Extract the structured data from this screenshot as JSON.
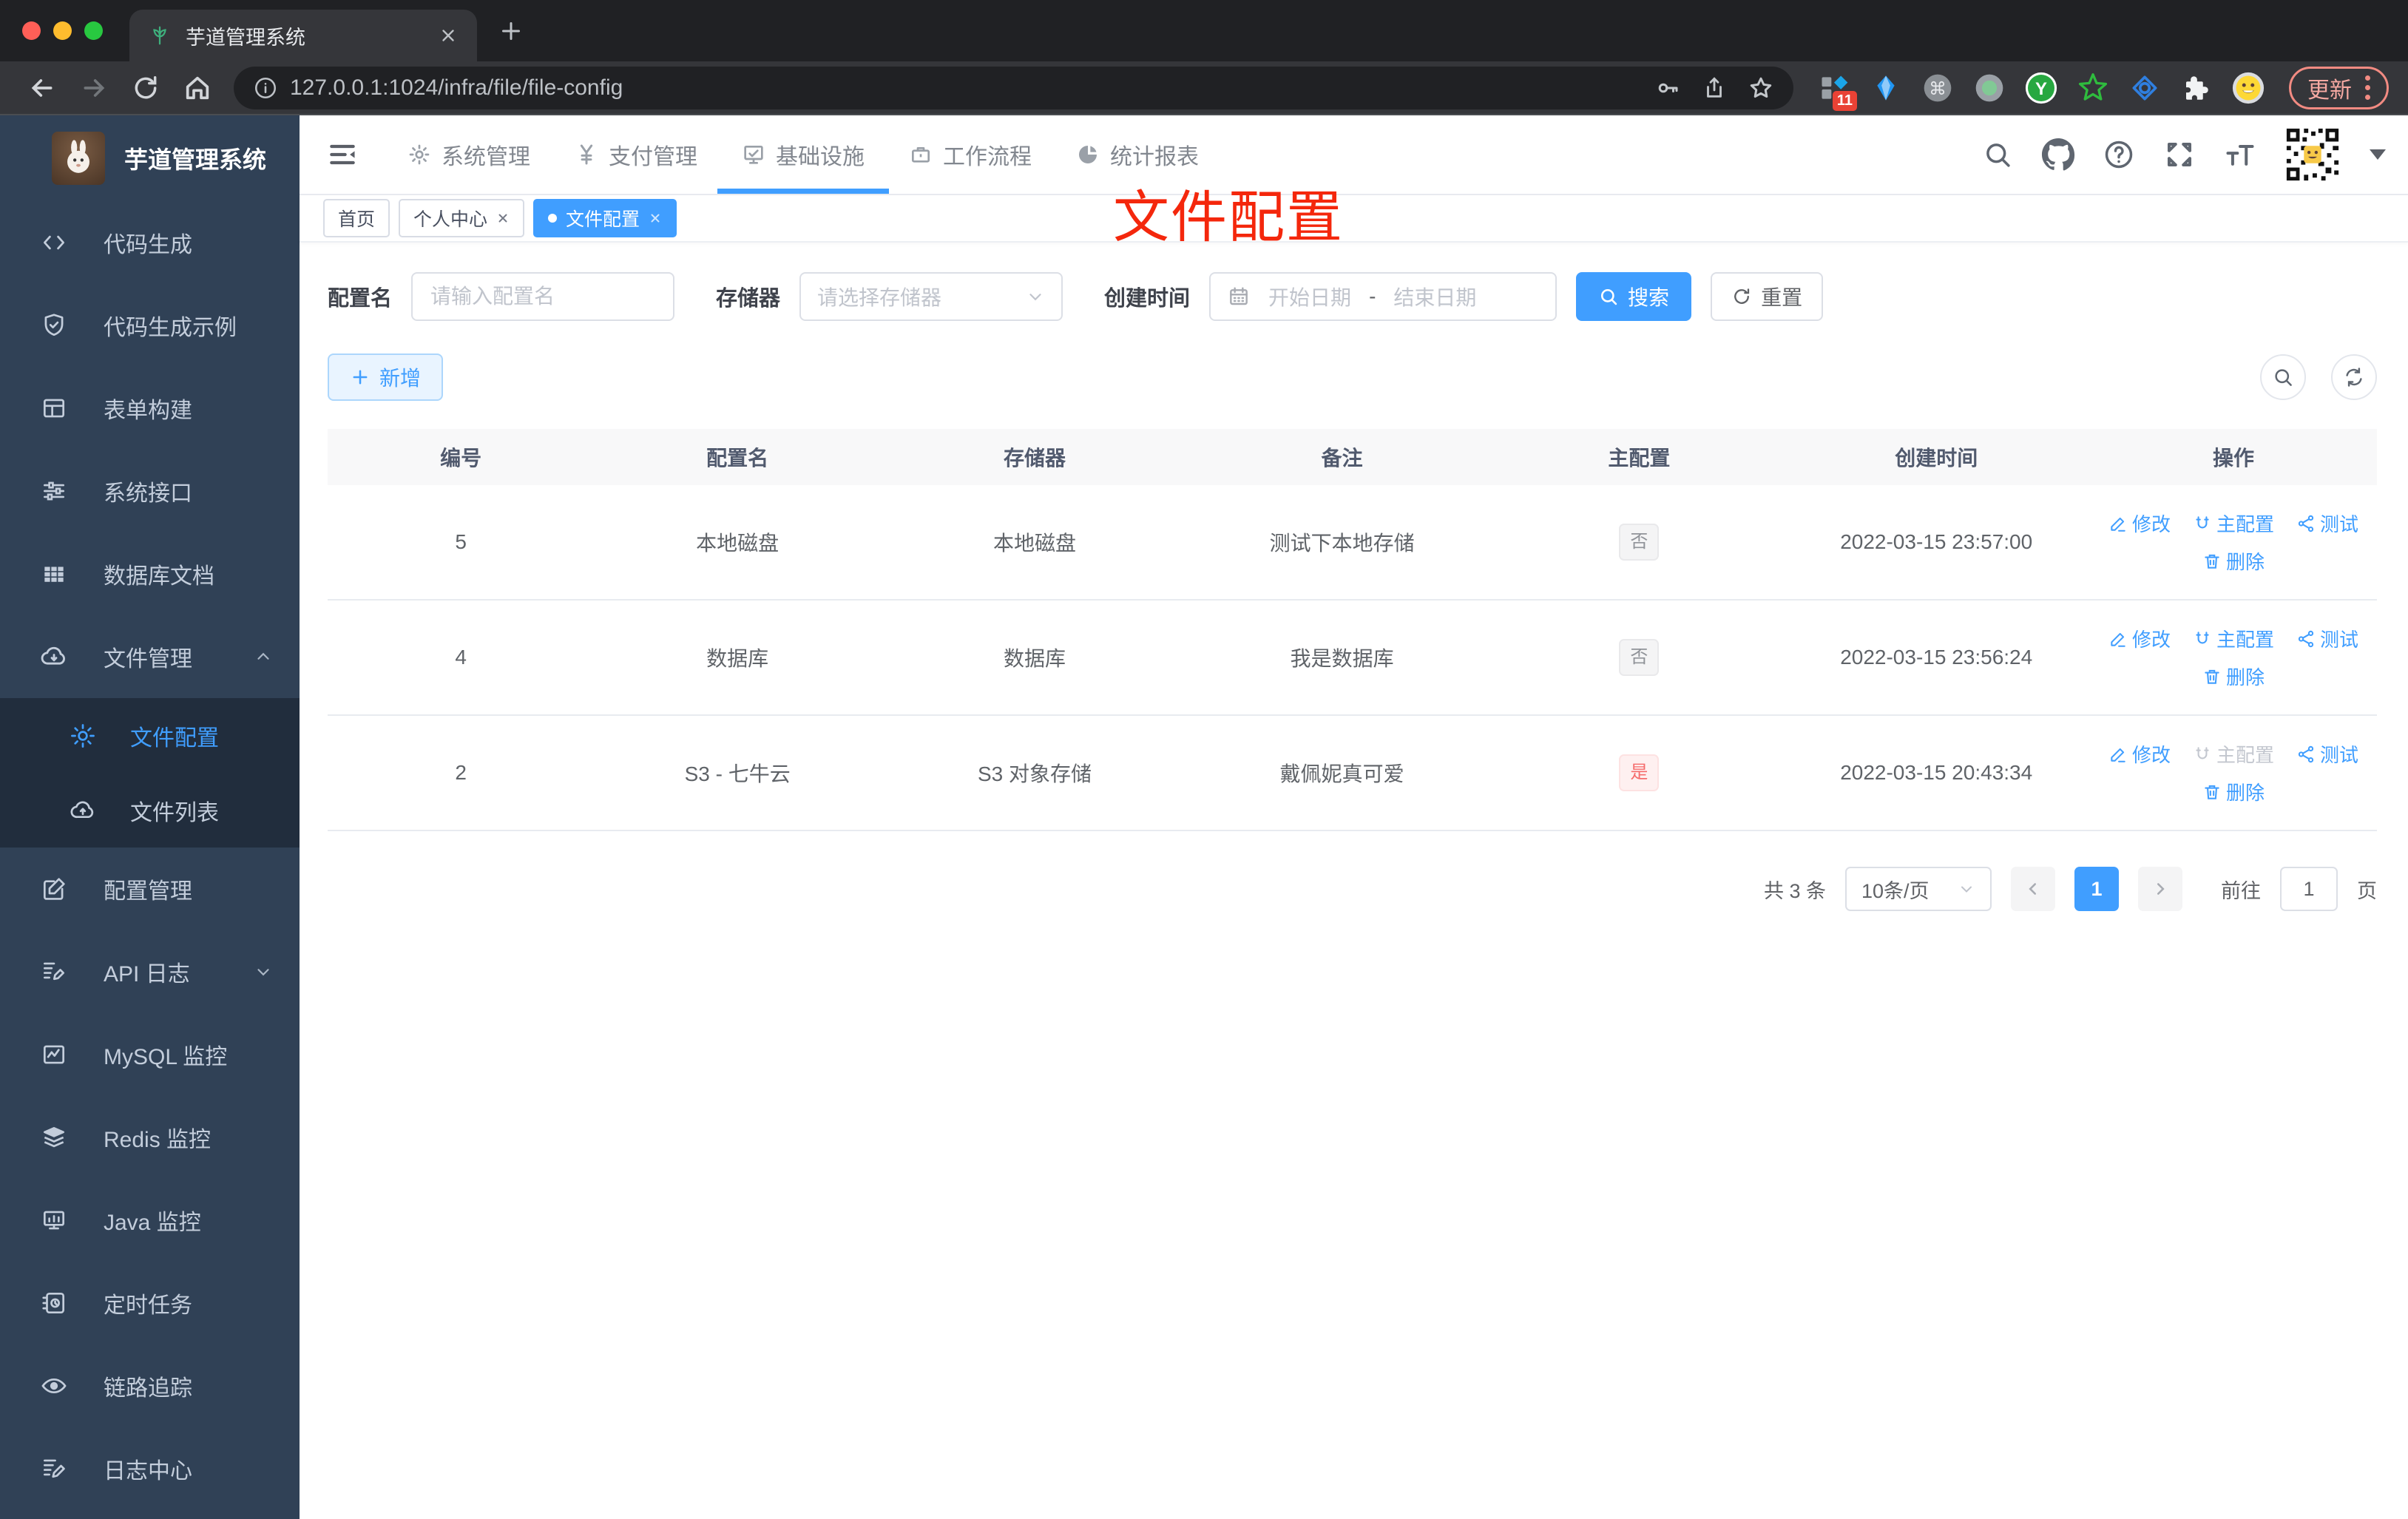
{
  "browser": {
    "tab_title": "芋道管理系统",
    "url": "127.0.0.1:1024/infra/file/file-config",
    "ext_badge": "11",
    "update_label": "更新"
  },
  "colors": {
    "accent": "#409eff",
    "sidebar_bg": "#304156",
    "submenu_bg": "#212d3d",
    "annotation_red": "#f4270c",
    "badge_no_text": "#909399",
    "badge_yes_text": "#f56c6c"
  },
  "sidebar": {
    "title": "芋道管理系统",
    "items": [
      {
        "label": "代码生成",
        "icon": "code-icon"
      },
      {
        "label": "代码生成示例",
        "icon": "shield-check-icon"
      },
      {
        "label": "表单构建",
        "icon": "form-icon"
      },
      {
        "label": "系统接口",
        "icon": "sliders-icon"
      },
      {
        "label": "数据库文档",
        "icon": "grid-icon"
      },
      {
        "label": "文件管理",
        "icon": "cloud-download-icon",
        "expanded": true,
        "children": [
          {
            "label": "文件配置",
            "icon": "gear-icon",
            "active": true
          },
          {
            "label": "文件列表",
            "icon": "cloud-upload-icon"
          }
        ]
      },
      {
        "label": "配置管理",
        "icon": "edit-square-icon"
      },
      {
        "label": "API 日志",
        "icon": "document-edit-icon",
        "collapsed": true
      },
      {
        "label": "MySQL 监控",
        "icon": "chart-box-icon"
      },
      {
        "label": "Redis 监控",
        "icon": "layers-icon"
      },
      {
        "label": "Java 监控",
        "icon": "monitor-icon"
      },
      {
        "label": "定时任务",
        "icon": "schedule-icon"
      },
      {
        "label": "链路追踪",
        "icon": "eye-icon"
      },
      {
        "label": "日志中心",
        "icon": "log-edit-icon"
      }
    ]
  },
  "topnav": {
    "menus": [
      {
        "label": "系统管理",
        "icon": "gear-icon"
      },
      {
        "label": "支付管理",
        "icon": "yen-icon"
      },
      {
        "label": "基础设施",
        "icon": "infra-board-icon",
        "active": true
      },
      {
        "label": "工作流程",
        "icon": "briefcase-icon"
      },
      {
        "label": "统计报表",
        "icon": "dashboard-icon"
      }
    ]
  },
  "tags": {
    "items": [
      {
        "label": "首页"
      },
      {
        "label": "个人中心",
        "closable": true
      },
      {
        "label": "文件配置",
        "closable": true,
        "active": true
      }
    ]
  },
  "annotation": {
    "text": "文件配置"
  },
  "filters": {
    "name_label": "配置名",
    "name_placeholder": "请输入配置名",
    "storage_label": "存储器",
    "storage_placeholder": "请选择存储器",
    "time_label": "创建时间",
    "date_start": "开始日期",
    "date_sep": "-",
    "date_end": "结束日期",
    "search_label": "搜索",
    "reset_label": "重置"
  },
  "toolbar": {
    "add_label": "新增"
  },
  "table": {
    "columns": [
      "编号",
      "配置名",
      "存储器",
      "备注",
      "主配置",
      "创建时间",
      "操作"
    ],
    "actions": {
      "edit": "修改",
      "master": "主配置",
      "test": "测试",
      "delete": "删除"
    },
    "rows": [
      {
        "id": "5",
        "name": "本地磁盘",
        "storage": "本地磁盘",
        "remark": "测试下本地存储",
        "master": "否",
        "created": "2022-03-15 23:57:00",
        "master_disabled": false
      },
      {
        "id": "4",
        "name": "数据库",
        "storage": "数据库",
        "remark": "我是数据库",
        "master": "否",
        "created": "2022-03-15 23:56:24",
        "master_disabled": false
      },
      {
        "id": "2",
        "name": "S3 - 七牛云",
        "storage": "S3 对象存储",
        "remark": "戴佩妮真可爱",
        "master": "是",
        "created": "2022-03-15 20:43:34",
        "master_disabled": true
      }
    ]
  },
  "pagination": {
    "total": "共 3 条",
    "page_size": "10条/页",
    "current": "1",
    "goto_label": "前往",
    "goto_value": "1",
    "page_unit": "页"
  }
}
